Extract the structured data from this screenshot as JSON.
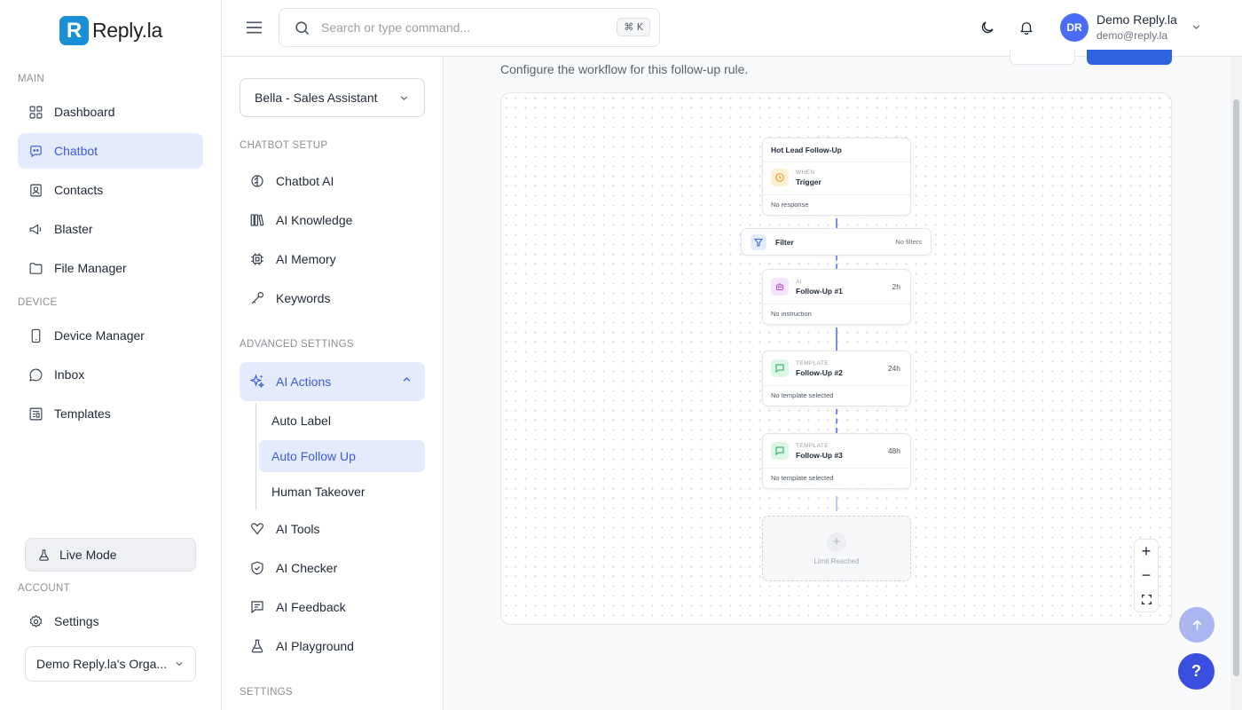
{
  "brand": {
    "logo_letter": "R",
    "name": "Reply.la",
    "color": "#1a8fd6"
  },
  "sidebar": {
    "section_main": "MAIN",
    "main_items": [
      {
        "label": "Dashboard",
        "icon": "dashboard-icon"
      },
      {
        "label": "Chatbot",
        "icon": "chatbot-icon",
        "active": true
      },
      {
        "label": "Contacts",
        "icon": "contacts-icon"
      },
      {
        "label": "Blaster",
        "icon": "megaphone-icon"
      },
      {
        "label": "File Manager",
        "icon": "folder-icon"
      }
    ],
    "section_device": "DEVICE",
    "device_items": [
      {
        "label": "Device Manager",
        "icon": "phone-icon"
      },
      {
        "label": "Inbox",
        "icon": "chat-bubble-icon"
      },
      {
        "label": "Templates",
        "icon": "templates-icon"
      }
    ],
    "live_mode": "Live Mode",
    "section_account": "ACCOUNT",
    "settings": "Settings",
    "org": "Demo Reply.la's Orga..."
  },
  "topbar": {
    "search_placeholder": "Search or type command...",
    "shortcut": "⌘ K",
    "user_initials": "DR",
    "user_name": "Demo Reply.la",
    "user_email": "demo@reply.la"
  },
  "subnav": {
    "bot_select": "Bella - Sales Assistant",
    "section_setup": "CHATBOT SETUP",
    "setup_items": [
      {
        "label": "Chatbot AI",
        "icon": "brain-icon"
      },
      {
        "label": "AI Knowledge",
        "icon": "library-icon"
      },
      {
        "label": "AI Memory",
        "icon": "chip-icon"
      },
      {
        "label": "Keywords",
        "icon": "key-icon"
      }
    ],
    "section_advanced": "ADVANCED SETTINGS",
    "ai_actions": "AI Actions",
    "ai_actions_children": [
      "Auto Label",
      "Auto Follow Up",
      "Human Takeover"
    ],
    "advanced_items": [
      {
        "label": "AI Tools",
        "icon": "tools-icon"
      },
      {
        "label": "AI Checker",
        "icon": "shield-check-icon"
      },
      {
        "label": "AI Feedback",
        "icon": "feedback-icon"
      },
      {
        "label": "AI Playground",
        "icon": "flask-icon"
      }
    ],
    "section_settings": "SETTINGS"
  },
  "main": {
    "description": "Configure the workflow for this follow-up rule."
  },
  "workflow": {
    "rule_name": "Hot Lead Follow-Up",
    "trigger": {
      "tag": "WHEN",
      "title": "Trigger",
      "footer": "No response"
    },
    "filter": {
      "label": "Filter",
      "value": "No filters"
    },
    "steps": [
      {
        "tag": "AI",
        "title": "Follow-Up #1",
        "time": "2h",
        "footer": "No instruction",
        "icon": "robot-icon"
      },
      {
        "tag": "TEMPLATE",
        "title": "Follow-Up #2",
        "time": "24h",
        "footer": "No template selected",
        "icon": "message-icon"
      },
      {
        "tag": "TEMPLATE",
        "title": "Follow-Up #3",
        "time": "48h",
        "footer": "No template selected",
        "icon": "message-icon"
      }
    ],
    "limit_text": "Limit Reached",
    "zoom_in": "+",
    "zoom_out": "−"
  },
  "fab": {
    "help": "?"
  },
  "colors": {
    "accent": "#3b5bdb",
    "accent_bg": "#e4ebfd",
    "primary_button": "#2f63e0",
    "connector": "#7b8ef0"
  }
}
